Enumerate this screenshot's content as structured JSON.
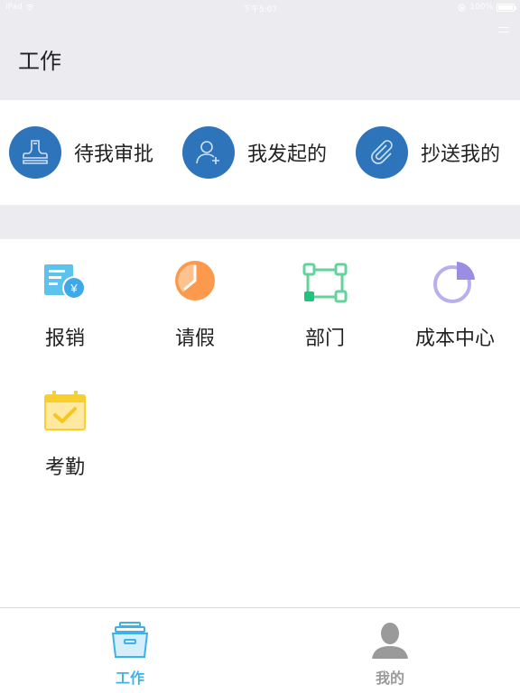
{
  "status_bar": {
    "device": "iPad",
    "time": "下午5:07",
    "battery": "100%"
  },
  "header": {
    "title": "工作"
  },
  "approvals": [
    {
      "label": "待我审批",
      "icon": "stamp-icon"
    },
    {
      "label": "我发起的",
      "icon": "user-add-icon"
    },
    {
      "label": "抄送我的",
      "icon": "paperclip-icon"
    }
  ],
  "grid": [
    {
      "label": "报销",
      "icon": "reimburse-icon"
    },
    {
      "label": "请假",
      "icon": "clock-icon"
    },
    {
      "label": "部门",
      "icon": "org-nodes-icon"
    },
    {
      "label": "成本中心",
      "icon": "pie-chart-icon"
    },
    {
      "label": "考勤",
      "icon": "calendar-check-icon"
    }
  ],
  "tabs": [
    {
      "label": "工作",
      "icon": "work-box-icon",
      "active": true
    },
    {
      "label": "我的",
      "icon": "profile-icon",
      "active": false
    }
  ],
  "colors": {
    "header_bg": "#ebebf0",
    "approval_circle": "#2e74bb",
    "tab_active": "#3cb2e9",
    "tab_inactive": "#9a9a9a"
  }
}
